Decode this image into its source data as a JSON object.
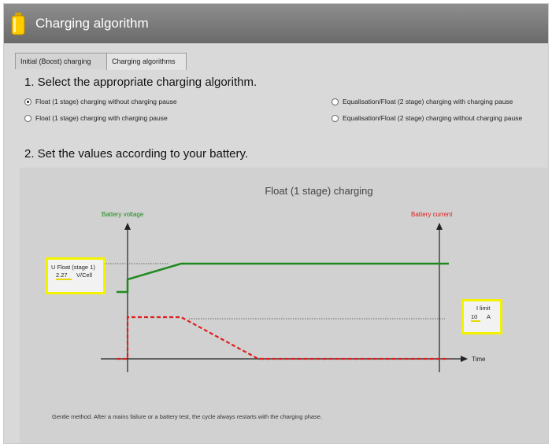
{
  "window": {
    "title": "Charging algorithm",
    "icon": "battery-icon"
  },
  "tabs": [
    {
      "label": "Initial (Boost) charging",
      "active": false
    },
    {
      "label": "Charging algorithms",
      "active": true
    }
  ],
  "section1": {
    "heading": "1. Select the appropriate charging algorithm.",
    "options": [
      {
        "label": "Float (1 stage) charging without charging pause",
        "selected": true
      },
      {
        "label": "Float (1 stage) charging with charging pause",
        "selected": false
      },
      {
        "label": "Equalisation/Float (2 stage) charging with charging pause",
        "selected": false
      },
      {
        "label": "Equalisation/Float (2 stage) charging without charging pause",
        "selected": false
      }
    ]
  },
  "section2": {
    "heading": "2. Set the values according to your battery.",
    "diagram": {
      "title": "Float (1 stage) charging",
      "battery_voltage_label": "Battery voltage",
      "battery_current_label": "Battery current",
      "time_label": "Time",
      "voltage_color": "#1e8a1e",
      "current_color": "#e01e1e",
      "u_float": {
        "label": "U Float (stage 1)",
        "value": "2.27",
        "unit": "V/Cell"
      },
      "i_limit": {
        "label": "I limit",
        "value": "10",
        "unit": "A"
      },
      "highlight_color": "#f3f300"
    },
    "footer": "Gentle method. After a mains failure or a battery test, the cycle always restarts with the charging phase."
  }
}
